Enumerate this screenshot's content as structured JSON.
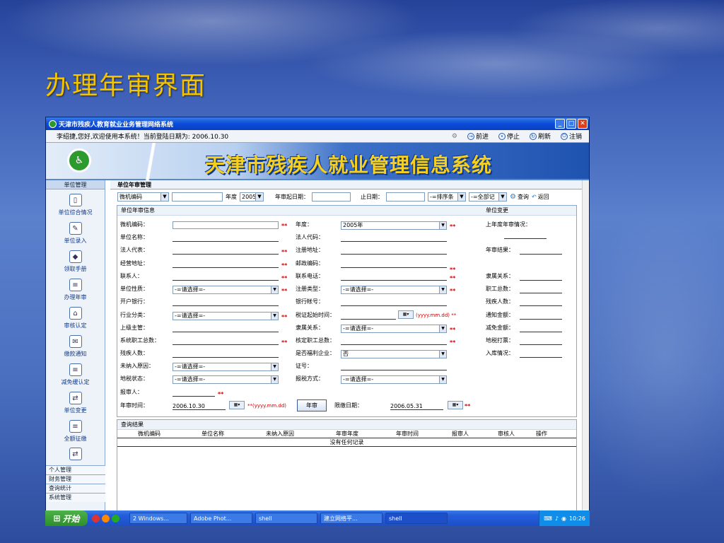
{
  "slide": {
    "title": "办理年审界面"
  },
  "window": {
    "title": "天津市残疾人教育就业业务管理网络系统",
    "welcome": "李绍捷,您好,欢迎使用本系统！当前登陆日期为: 2006.10.30",
    "nav": {
      "forward": "前进",
      "stop": "停止",
      "refresh": "刷新",
      "logout": "注销"
    },
    "banner_title": "天津市残疾人就业管理信息系统"
  },
  "sidebar": {
    "header": "单位管理",
    "items": [
      {
        "label": "单位综合情况",
        "icon": "document-icon"
      },
      {
        "label": "单位录入",
        "icon": "edit-icon"
      },
      {
        "label": "领取手册",
        "icon": "disc-icon"
      },
      {
        "label": "办理年审",
        "icon": "notepad-icon"
      },
      {
        "label": "审核认定",
        "icon": "house-icon"
      },
      {
        "label": "缴款通知",
        "icon": "mail-icon"
      },
      {
        "label": "减免缓认定",
        "icon": "notepad-icon"
      },
      {
        "label": "单位变更",
        "icon": "network-icon"
      },
      {
        "label": "全额征缴",
        "icon": "notepad-icon"
      }
    ],
    "groups": [
      "个人管理",
      "财务管理",
      "查询统计",
      "系统管理"
    ]
  },
  "main": {
    "breadcrumb": "单位年审管理",
    "search": {
      "field_select": "微机编码",
      "year_label": "年度",
      "year_value": "2005",
      "start_label": "年审起日期：",
      "end_label": "止日期：",
      "sort_select": "-=排序条",
      "all_select": "-=全部记",
      "query": "查询",
      "back": "返回"
    },
    "form": {
      "header": "单位年审信息",
      "change_header": "单位变更",
      "labels": {
        "computer_code": "微机编码：",
        "unit_name": "单位名称：",
        "legal_rep": "法人代表：",
        "address": "经营地址：",
        "contact": "联系人：",
        "unit_nature": "单位性质：",
        "bank": "开户银行：",
        "industry": "行业分类：",
        "supervisor": "上级主管：",
        "total_staff": "系统职工总数：",
        "disabled_count": "残疾人数：",
        "reason": "未纳入原因：",
        "tax_status": "地税状态：",
        "reporter": "报审人：",
        "review_time": "年审时间：",
        "year": "年度：",
        "legal_code": "法人代码：",
        "reg_address": "注册地址：",
        "postcode": "邮政编码：",
        "phone": "联系电话：",
        "reg_type": "注册类型：",
        "account": "银行帐号：",
        "tax_start": "税证起始时间：",
        "affiliation": "隶属关系：",
        "approved_staff": "核定职工总数：",
        "welfare": "是否福利企业：",
        "cert_no": "证号：",
        "tax_method": "报税方式：",
        "deadline": "限缴日期：",
        "last_year": "上年度年审情况：",
        "result": "年审结果：",
        "subordinate": "隶属关系：",
        "staff_total": "职工总数：",
        "disabled_total": "残疾人数：",
        "notice_amount": "通知金额：",
        "reduce_amount": "减免金额：",
        "tax_ticket": "地税打票：",
        "warehouse": "入库情况："
      },
      "values": {
        "year": "2005年",
        "welfare": "否",
        "review_time": "2006.10.30",
        "deadline": "2006.05.31",
        "select_placeholder": "-=请选择=-"
      },
      "required": "**",
      "date_format": "(yyyy.mm.dd)",
      "submit": "年审"
    },
    "results": {
      "header": "查询结果",
      "columns": [
        "微机编码",
        "单位名称",
        "未纳入原因",
        "年审年度",
        "年审时间",
        "报审人",
        "审核人",
        "操作"
      ],
      "empty": "没有任何记录"
    }
  },
  "taskbar": {
    "start": "开始",
    "tasks": [
      "2 Windows...",
      "Adobe Phot...",
      "shell",
      "建立网络平...",
      "shell"
    ],
    "clock": "10:26"
  }
}
